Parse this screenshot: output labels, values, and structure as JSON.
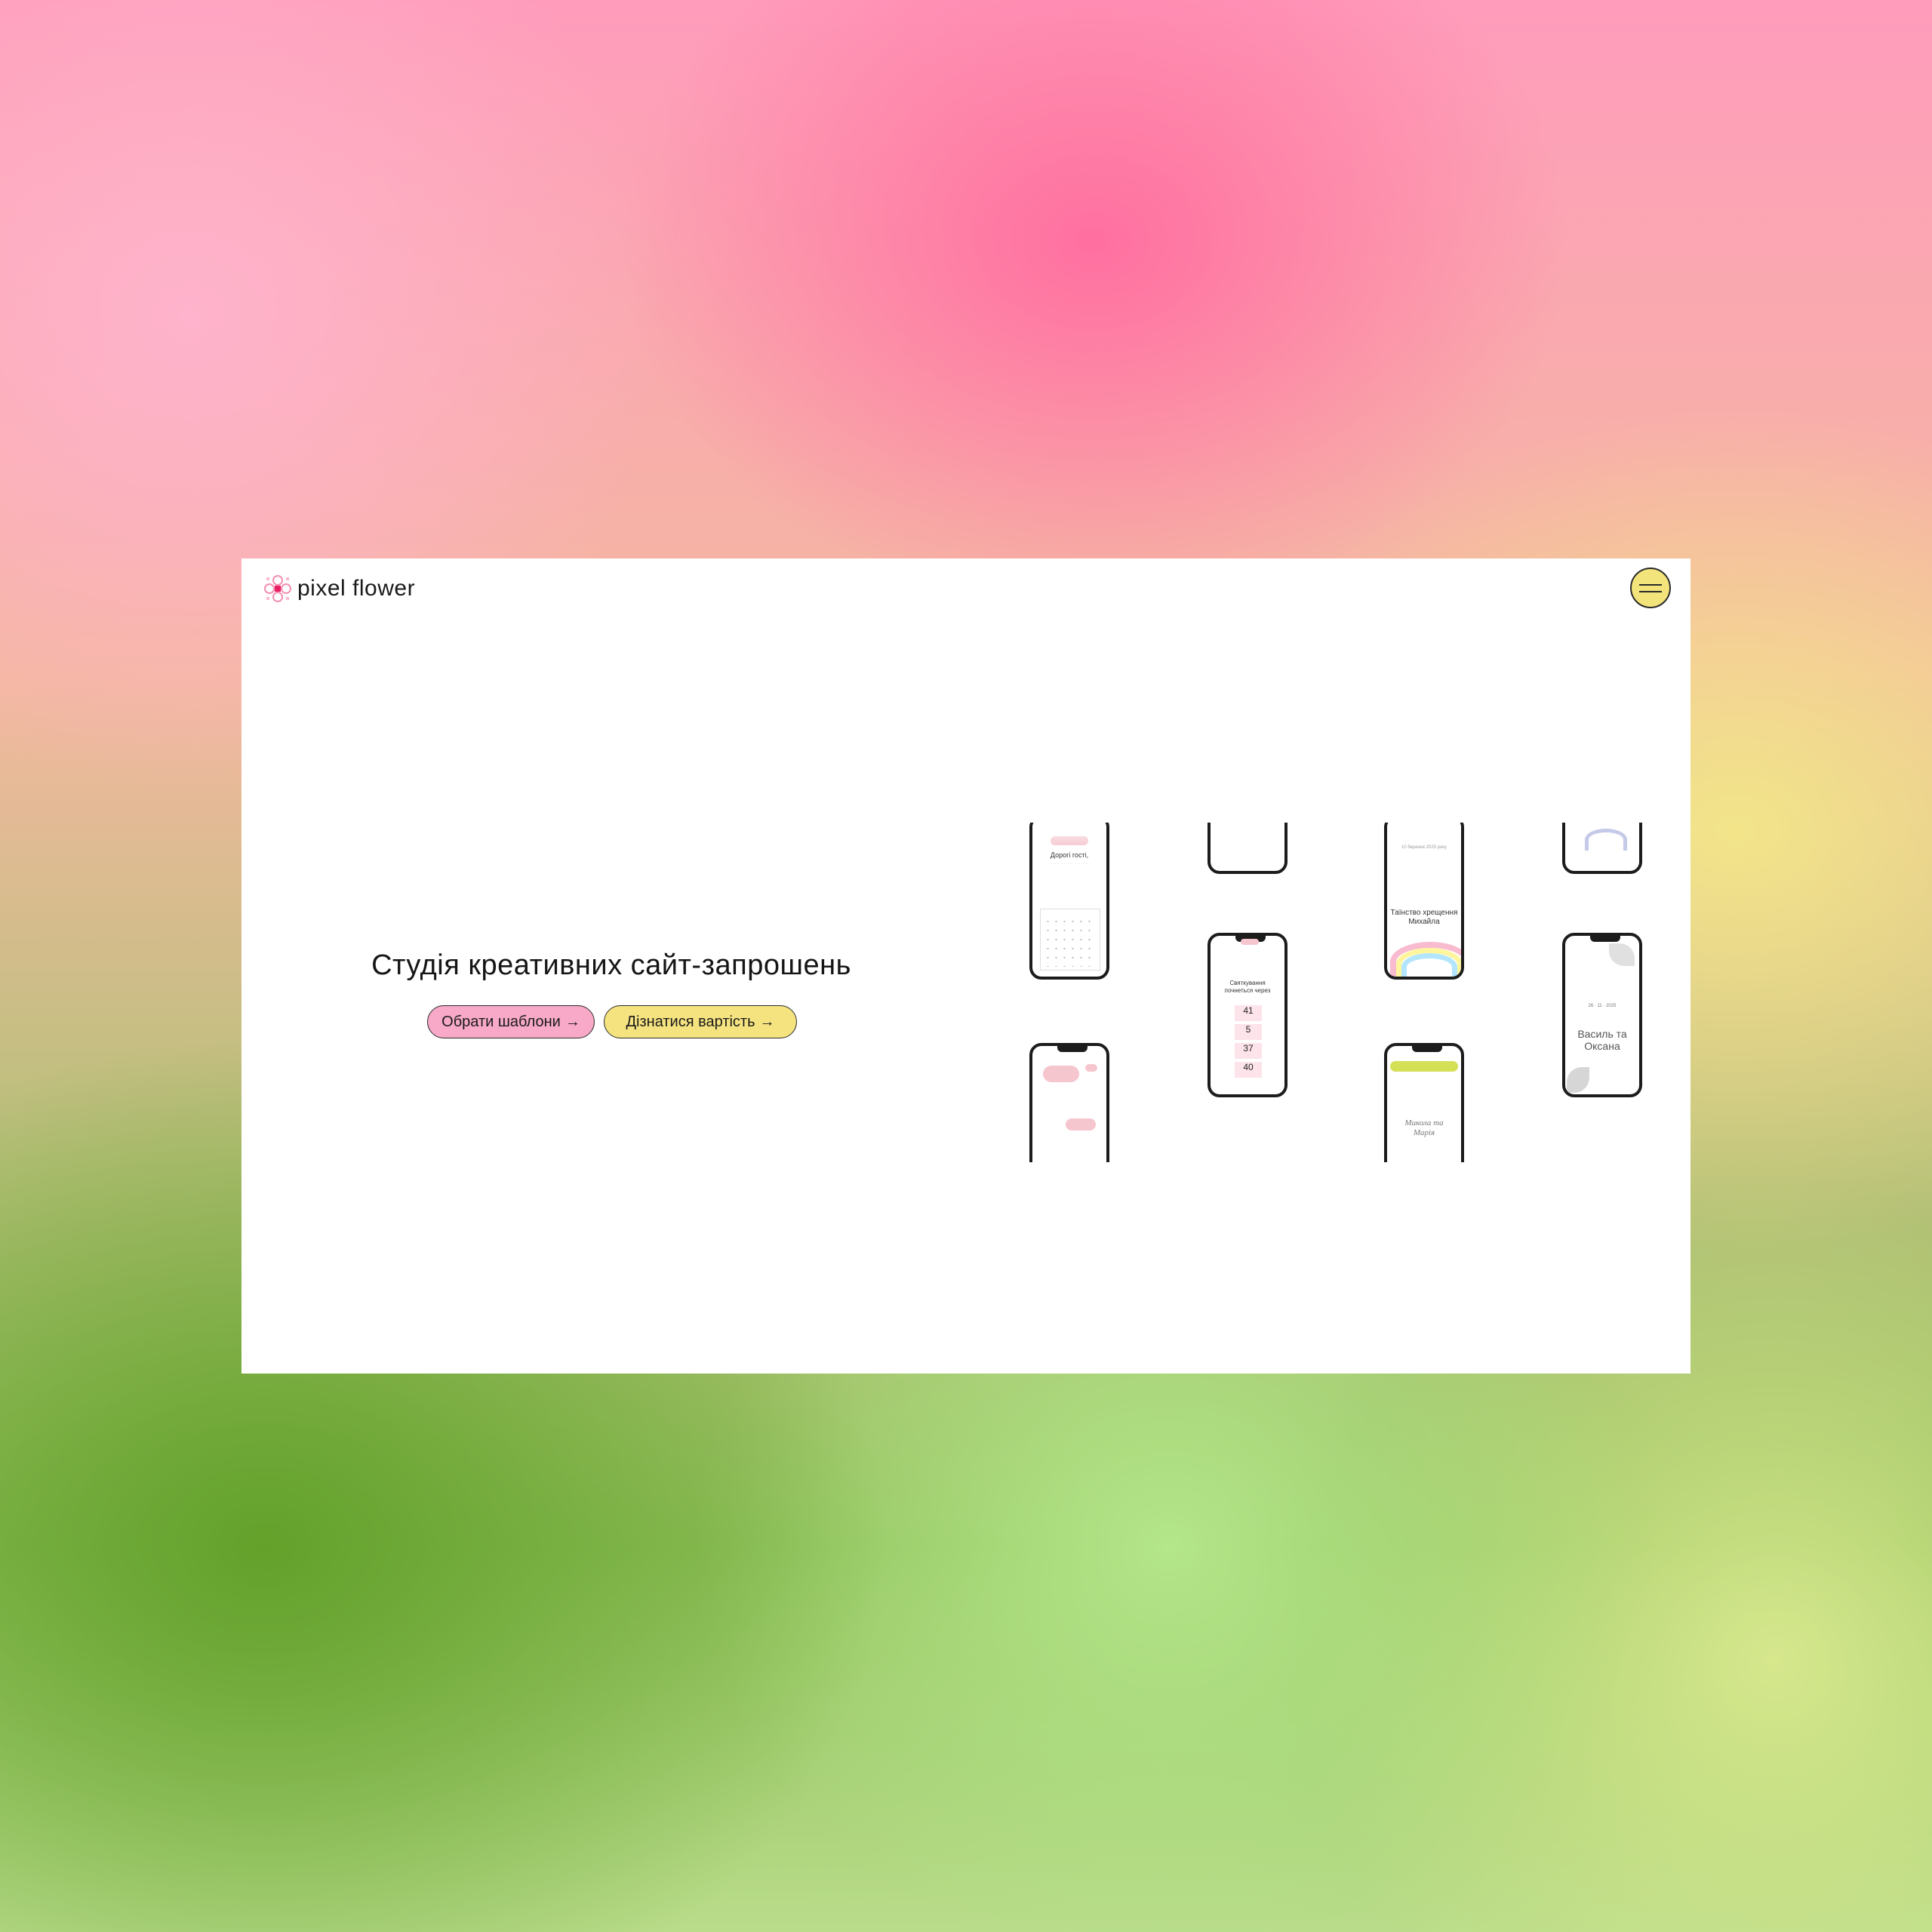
{
  "header": {
    "logo_text": "pixel flower",
    "menu_icon": "hamburger-icon"
  },
  "hero": {
    "title": "Студія креативних сайт-запрошень",
    "btn_templates": "Обрати шаблони",
    "btn_price": "Дізнатися вартість",
    "arrow": "→"
  },
  "phones": {
    "p1_heading": "Дорогі гості,",
    "p3_date": "10 березня 2025 року",
    "p3_title": "Таїнство хрещення Михайла",
    "p4_heading": "Святкування почнеться через",
    "p4_values": [
      "41",
      "5",
      "37",
      "40"
    ],
    "p6_date": "26 · 11 · 2025",
    "p6_names": "Василь та Оксана",
    "p8_names": "Микола та Марія"
  },
  "colors": {
    "accent_pink": "#f7a9c7",
    "accent_yellow": "#f5e380",
    "window_bg": "#ffffff"
  }
}
